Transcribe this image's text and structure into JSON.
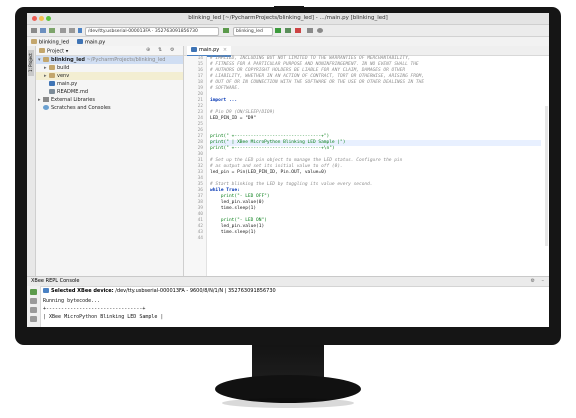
{
  "window": {
    "title": "blinking_led [~/PycharmProjects/blinking_led] - .../main.py [blinking_led]"
  },
  "toolbar": {
    "device_combo": "/dev/tty.usbserial-000013FA · 352763091856730",
    "run_config": "blinking_led"
  },
  "navbar": {
    "project": "blinking_led",
    "file": "main.py"
  },
  "project_panel": {
    "header": "Project",
    "root_name": "blinking_led",
    "root_path": "~/PycharmProjects/blinking_led",
    "items": [
      {
        "label": "build"
      },
      {
        "label": "venv"
      },
      {
        "label": "main.py"
      },
      {
        "label": "README.md"
      },
      {
        "label": "External Libraries"
      },
      {
        "label": "Scratches and Consoles"
      }
    ]
  },
  "side_strip": {
    "project_tab": "1: Project"
  },
  "editor": {
    "tab": "main.py",
    "line_numbers": [
      "14",
      "15",
      "16",
      "17",
      "18",
      "19",
      "20",
      "21",
      "22",
      "23",
      "24",
      "25",
      "26",
      "27",
      "28",
      "29",
      "30",
      "31",
      "32",
      "33",
      "34",
      "35",
      "36",
      "37",
      "38",
      "39",
      "40",
      "41",
      "42",
      "43",
      "44"
    ],
    "lines": [
      "# IMPLIED, INCLUDING BUT NOT LIMITED TO THE WARRANTIES OF MERCHANTABILITY,",
      "# FITNESS FOR A PARTICULAR PURPOSE AND NONINFRINGEMENT. IN NO EVENT SHALL THE",
      "# AUTHORS OR COPYRIGHT HOLDERS BE LIABLE FOR ANY CLAIM, DAMAGES OR OTHER",
      "# LIABILITY, WHETHER IN AN ACTION OF CONTRACT, TORT OR OTHERWISE, ARISING FROM,",
      "# OUT OF OR IN CONNECTION WITH THE SOFTWARE OR THE USE OR OTHER DEALINGS IN THE",
      "# SOFTWARE.",
      "",
      "import ...",
      "",
      "# Pin D9 (ON/SLEEP/DIO9)",
      "LED_PIN_ID = \"D9\"",
      "",
      "",
      "print(\" +--------------------------------+\")",
      "print(\" | XBee MicroPython Blinking LED Sample |\")",
      "print(\" +--------------------------------+\\n\")",
      "",
      "# Set up the LED pin object to manage the LED status. Configure the pin",
      "# as output and set its initial value to off (0).",
      "led_pin = Pin(LED_PIN_ID, Pin.OUT, value=0)",
      "",
      "# Start blinking the LED by toggling its value every second.",
      "while True:",
      "    print(\"- LED OFF\")",
      "    led_pin.value(0)",
      "    time.sleep(1)",
      "",
      "    print(\"- LED ON\")",
      "    led_pin.value(1)",
      "    time.sleep(1)",
      ""
    ]
  },
  "console": {
    "title": "XBee REPL Console",
    "device_prefix": "Selected XBee device:",
    "device_info": "/dev/tty.usbserial-000013FA - 9600/8/N/1/N | 352763091856730",
    "lines": [
      "Running bytecode...",
      "+--------------------------------+",
      "| XBee MicroPython Blinking LED Sample |"
    ]
  },
  "colors": {
    "selection": "#d0def3",
    "accent": "#4b82c4",
    "comment": "#8c8c8c",
    "keyword": "#0033b3",
    "string": "#067d17"
  }
}
